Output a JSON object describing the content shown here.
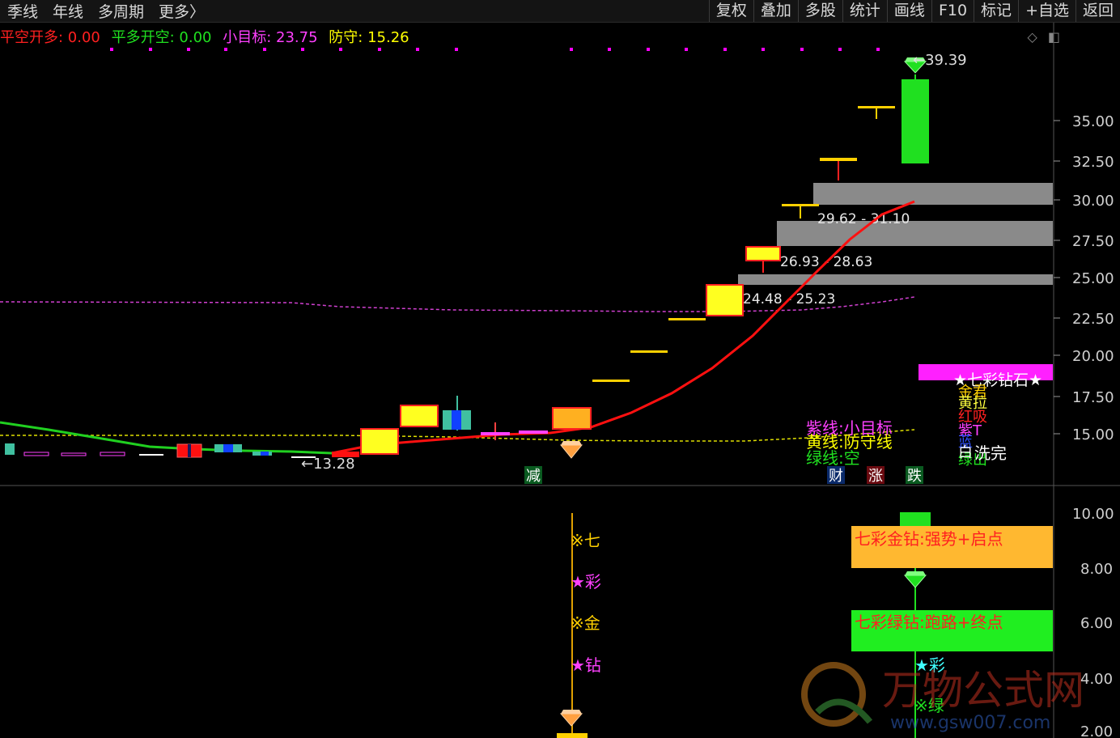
{
  "toolbar": {
    "left": [
      "季线",
      "年线",
      "多周期",
      "更多〉"
    ],
    "right": [
      "复权",
      "叠加",
      "多股",
      "统计",
      "画线",
      "F10",
      "标记",
      "+自选",
      "返回"
    ]
  },
  "legend": [
    {
      "label": "平空开多: 0.00",
      "color": "#ff2020"
    },
    {
      "label": "平多开空: 0.00",
      "color": "#20e020"
    },
    {
      "label": "小目标: 23.75",
      "color": "#ff40ff"
    },
    {
      "label": "防守: 15.26",
      "color": "#ffff00"
    }
  ],
  "main_axis": {
    "ticks": [
      "35.00",
      "32.50",
      "30.00",
      "27.50",
      "25.00",
      "22.50",
      "20.00",
      "17.50",
      "15.00"
    ]
  },
  "sub_axis": {
    "ticks": [
      "10.00",
      "8.00",
      "6.00",
      "4.00",
      "2.00"
    ]
  },
  "price_labels": {
    "high": "39.39",
    "low": "13.28"
  },
  "zones": [
    "29.62 - 31.10",
    "26.93 - 28.63",
    "24.48 - 25.23"
  ],
  "side_labels": {
    "banner": "★七彩钻石★",
    "lines": [
      "金君",
      "黄拉",
      "红吸",
      "紫T",
      "蓝",
      "绿出"
    ],
    "wash": "洗完",
    "wash_prefix": "白"
  },
  "line_legend": [
    {
      "label": "紫线:小目标",
      "color": "#ff40ff"
    },
    {
      "label": "黄线:防守线",
      "color": "#ffff00"
    },
    {
      "label": "绿线:空",
      "color": "#20e020"
    }
  ],
  "bottom_marks": {
    "jian": "减",
    "cai": "财",
    "zhang": "涨",
    "die": "跌"
  },
  "sub_labels": [
    "※七",
    "★彩",
    "※金",
    "★钻"
  ],
  "sub_boxes": {
    "gold": "七彩金钻:强势+启点",
    "green": "七彩绿钻:跑路+终点"
  },
  "sub_lower": [
    "★彩",
    "※绿"
  ],
  "watermark": {
    "cn": "万物公式网",
    "url": "www.gsw007.com"
  }
}
